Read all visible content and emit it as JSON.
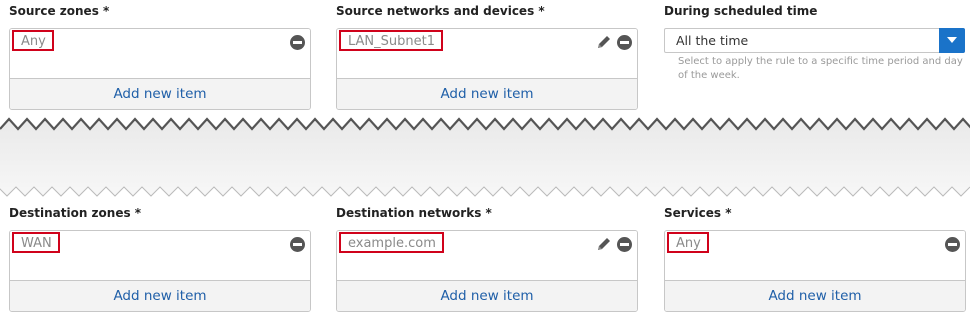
{
  "top_row": {
    "source_zones": {
      "label": "Source zones *",
      "item": "Any",
      "add_label": "Add new item"
    },
    "source_networks": {
      "label": "Source networks and devices *",
      "item": "LAN_Subnet1",
      "add_label": "Add new item"
    },
    "schedule": {
      "label": "During scheduled time",
      "selected": "All the time",
      "help": "Select to apply the rule to a specific time period and day of the week."
    }
  },
  "bottom_row": {
    "destination_zones": {
      "label": "Destination zones *",
      "item": "WAN",
      "add_label": "Add new item"
    },
    "destination_networks": {
      "label": "Destination networks *",
      "item": "example.com",
      "add_label": "Add new item"
    },
    "services": {
      "label": "Services *",
      "item": "Any",
      "add_label": "Add new item"
    }
  },
  "colors": {
    "highlight": "#d0021b",
    "link": "#1f5fa8",
    "dropdown_accent": "#1a73c9"
  },
  "icons": [
    "remove-icon",
    "edit-icon",
    "chevron-down-icon"
  ]
}
